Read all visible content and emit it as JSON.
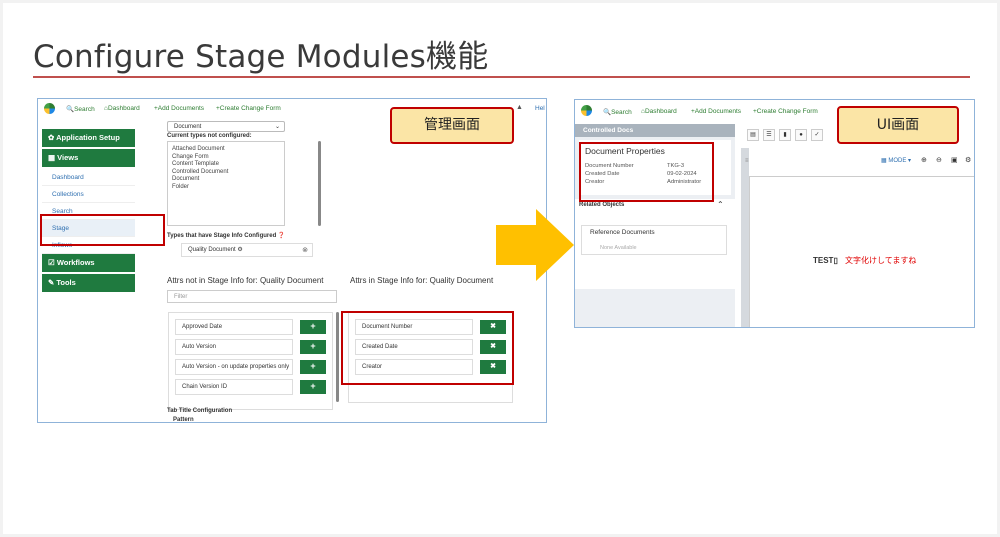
{
  "slide": {
    "title": "Configure Stage Modules機能"
  },
  "admin": {
    "callout": "管理画面",
    "nav": [
      "Search",
      "Dashboard",
      "Add Documents",
      "Create Change Form"
    ],
    "nav_right": "Hel",
    "sidebar": {
      "app_setup": "Application Setup",
      "views": "Views",
      "items": [
        "Dashboard",
        "Collections",
        "Search",
        "Stage",
        "Inflows"
      ],
      "workflows": "Workflows",
      "tools": "Tools"
    },
    "type_select": "Document",
    "not_configured_label": "Current types not configured:",
    "not_configured": [
      "Attached Document",
      "Change Form",
      "Content Template",
      "Controlled Document",
      "Document",
      "Folder"
    ],
    "configured_label": "Types that have Stage Info Configured",
    "configured_chip": "Quality Document",
    "attrs_not_title": "Attrs not in Stage Info for: Quality Document",
    "attrs_in_title": "Attrs in Stage Info for: Quality Document",
    "filter_placeholder": "Filter",
    "attrs_not": [
      "Approved Date",
      "Auto Version",
      "Auto Version - on update properties only",
      "Chain Version ID"
    ],
    "attrs_in": [
      "Document Number",
      "Created Date",
      "Creator"
    ],
    "add_symbol": "+",
    "remove_symbol": "✖",
    "tab_title_config": "Tab Title Configuration",
    "pattern": "Pattern"
  },
  "ui": {
    "callout": "UI画面",
    "nav": [
      "Search",
      "Dashboard",
      "Add Documents",
      "Create Change Form"
    ],
    "sidebar_head": "Controlled Docs",
    "doc_props_title": "Document Properties",
    "props": [
      {
        "label": "Document Number",
        "value": "TKG-3"
      },
      {
        "label": "Created Date",
        "value": "09-02-2024"
      },
      {
        "label": "Creator",
        "value": "Administrator"
      }
    ],
    "related_objects": "Related Objects",
    "reference_docs": "Reference Documents",
    "none_available": "None Available",
    "mode_label": "MODE",
    "doc_text": "TEST▯",
    "note": "文字化けしてますね"
  },
  "colors": {
    "accent_green": "#1f7a3f",
    "highlight_red": "#c00000",
    "callout_fill": "#fbe5a6",
    "arrow": "#ffc000"
  }
}
